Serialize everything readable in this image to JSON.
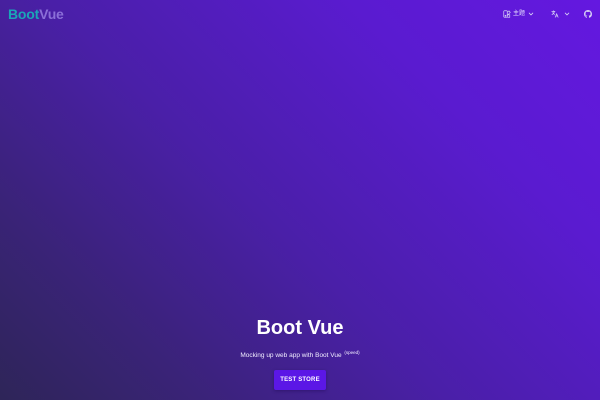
{
  "navbar": {
    "brand_part1": "Boot",
    "brand_part2": "Vue",
    "theme_label": "主题",
    "icons": {
      "theme": "swatch-icon",
      "language": "translate-icon",
      "github": "github-icon",
      "dropdown": "chevron-down-icon"
    }
  },
  "hero": {
    "title": "Boot Vue",
    "subtitle": "Mocking up web app with Boot Vue",
    "subtitle_sup": "(speed)",
    "cta_label": "TEST STORE"
  },
  "colors": {
    "brand_boot": "#1aa6b7",
    "brand_vue": "#8b6fd8",
    "gradient_start": "#6418e0",
    "gradient_end": "#2e2558",
    "cta_background": "#5b17e6"
  }
}
